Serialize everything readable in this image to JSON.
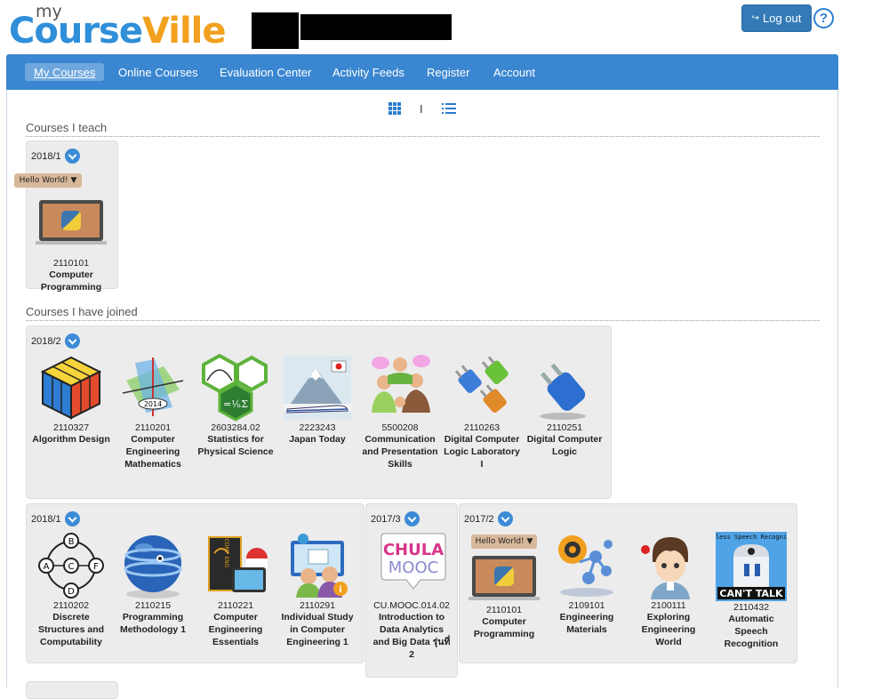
{
  "brand": {
    "my": "my",
    "logo_course": "Course",
    "logo_ville": "Ville"
  },
  "header": {
    "logout_label": "Log out",
    "logout_icon": "sign-out-icon",
    "help_label": "?"
  },
  "nav": {
    "items": [
      {
        "label": "My Courses",
        "active": true
      },
      {
        "label": "Online Courses"
      },
      {
        "label": "Evaluation Center"
      },
      {
        "label": "Activity Feeds"
      },
      {
        "label": "Register"
      },
      {
        "label": "Account"
      }
    ]
  },
  "view_toggle": {
    "separator": "I"
  },
  "teach": {
    "title": "Courses I teach",
    "groups": [
      {
        "term": "2018/1",
        "courses": [
          {
            "badge": "Hello World!",
            "code": "2110101",
            "name": "Computer Programming"
          }
        ]
      }
    ]
  },
  "joined": {
    "title": "Courses I have joined",
    "groups": [
      {
        "term": "2018/2",
        "courses": [
          {
            "code": "2110327",
            "name": "Algorithm Design"
          },
          {
            "code": "2110201",
            "name": "Computer Engineering Mathematics"
          },
          {
            "code": "2603284.02",
            "name": "Statistics for Physical Science"
          },
          {
            "code": "2223243",
            "name": "Japan Today"
          },
          {
            "code": "5500208",
            "name": "Communication and Presentation Skills"
          },
          {
            "code": "2110263",
            "name": "Digital Computer Logic Laboratory I"
          },
          {
            "code": "2110251",
            "name": "Digital Computer Logic"
          }
        ]
      },
      {
        "term": "2018/1",
        "courses": [
          {
            "code": "2110202",
            "name": "Discrete Structures and Computability"
          },
          {
            "code": "2110215",
            "name": "Programming Methodology 1"
          },
          {
            "code": "2110221",
            "name": "Computer Engineering Essentials"
          },
          {
            "code": "2110291",
            "name": "Individual Study in Computer Engineering 1"
          }
        ]
      },
      {
        "term": "2017/3",
        "courses": [
          {
            "code": "CU.MOOC.014.02",
            "name": "Introduction to Data Analytics and Big Data รุ่นที่ 2",
            "thumb_text": "CHULA MOOC"
          }
        ]
      },
      {
        "term": "2017/2",
        "courses": [
          {
            "badge": "Hello World!",
            "code": "2110101",
            "name": "Computer Programming"
          },
          {
            "code": "2109101",
            "name": "Engineering Materials"
          },
          {
            "code": "2100111",
            "name": "Exploring Engineering World"
          },
          {
            "code": "2110432",
            "name": "Automatic Speech Recognition",
            "thumb_text": "Flawless Speech Recognition",
            "thumb_text2": "CAN'T TALK"
          }
        ]
      }
    ]
  }
}
